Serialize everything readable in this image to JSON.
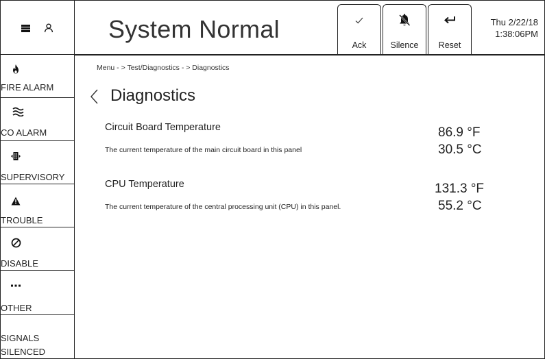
{
  "header": {
    "status_title": "System Normal",
    "buttons": [
      {
        "id": "ack",
        "label": "Ack",
        "icon": "checkmark-icon"
      },
      {
        "id": "silence",
        "label": "Silence",
        "icon": "bell-muted-icon"
      },
      {
        "id": "reset",
        "label": "Reset",
        "icon": "return-arrow-icon"
      }
    ],
    "date": "Thu 2/22/18",
    "time": "1:38:06PM"
  },
  "sidebar": {
    "items": [
      {
        "label": "FIRE ALARM",
        "icon": "flame-icon"
      },
      {
        "label": "CO ALARM",
        "icon": "wavy-lines-icon"
      },
      {
        "label": "SUPERVISORY",
        "icon": "supervisory-icon"
      },
      {
        "label": "TROUBLE",
        "icon": "warning-triangle-icon"
      },
      {
        "label": "DISABLE",
        "icon": "slashed-circle-icon"
      },
      {
        "label": "OTHER",
        "icon": "ellipsis-icon"
      }
    ],
    "signals_silenced": [
      "SIGNALS",
      "SILENCED"
    ]
  },
  "breadcrumb": "Menu - > Test/Diagnostics - > Diagnostics",
  "page_title": "Diagnostics",
  "diagnostics": [
    {
      "title": "Circuit Board Temperature",
      "description": "The current temperature of the main circuit board in this panel",
      "fahrenheit": "86.9 °F",
      "celsius": "30.5 °C"
    },
    {
      "title": "CPU Temperature",
      "description": "The current temperature of the central processing unit (CPU) in this panel.",
      "fahrenheit": "131.3 °F",
      "celsius": "55.2 °C"
    }
  ]
}
